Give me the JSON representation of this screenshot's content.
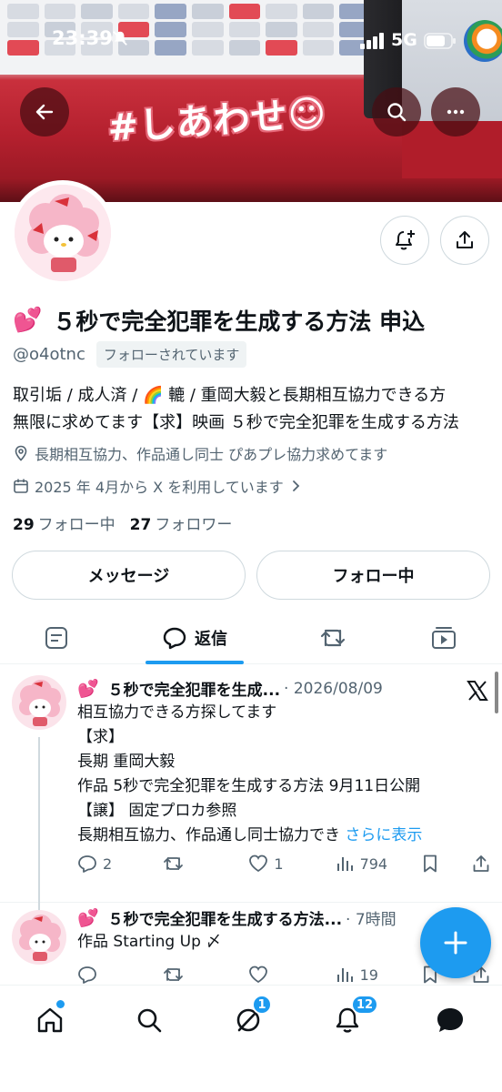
{
  "status_bar": {
    "time": "23:39",
    "network": "5G"
  },
  "banner": {
    "hashtag_text": "#しあわせ☺"
  },
  "profile": {
    "emoji": "💕",
    "name": "５秒で完全犯罪を生成する方法 申込",
    "handle": "@o4otnc",
    "follows_you": "フォローされています",
    "bio_line1": "取引垢 / 成人済 / 🌈 轆 / 重岡大毅と長期相互協力できる方",
    "bio_line2": "無限に求めてます【求】映画 ５秒で完全犯罪を生成する方法",
    "location": "長期相互協力、作品通し同士 ぴあプレ協力求めてます",
    "joined": "2025 年 4月から X を利用しています",
    "following_count": "29",
    "following_label": "フォロー中",
    "followers_count": "27",
    "followers_label": "フォロワー"
  },
  "buttons": {
    "message": "メッセージ",
    "following": "フォロー中"
  },
  "tabs": {
    "active_label": "返信"
  },
  "tweets": [
    {
      "emoji": "💕",
      "name": "５秒で完全犯罪を生成...",
      "date": "· 2026/08/09",
      "lines": [
        "相互協力できる方探してます",
        "【求】",
        "長期 重岡大毅",
        "作品 5秒で完全犯罪を生成する方法 9月11日公開",
        "【譲】 固定プロカ参照",
        "長期相互協力、作品通し同士協力でき"
      ],
      "more": "さらに表示",
      "replies": "2",
      "retweets": "",
      "likes": "1",
      "views": "794"
    },
    {
      "emoji": "💕",
      "name": "５秒で完全犯罪を生成する方法...",
      "date": "· 7時間",
      "lines": [
        "作品 Starting Up 〆"
      ],
      "views": "19"
    }
  ],
  "bottom_nav": {
    "grok_badge": "1",
    "notifications_badge": "12"
  },
  "colors": {
    "accent": "#1d9bf0",
    "text": "#0f1419",
    "secondary": "#536471"
  }
}
